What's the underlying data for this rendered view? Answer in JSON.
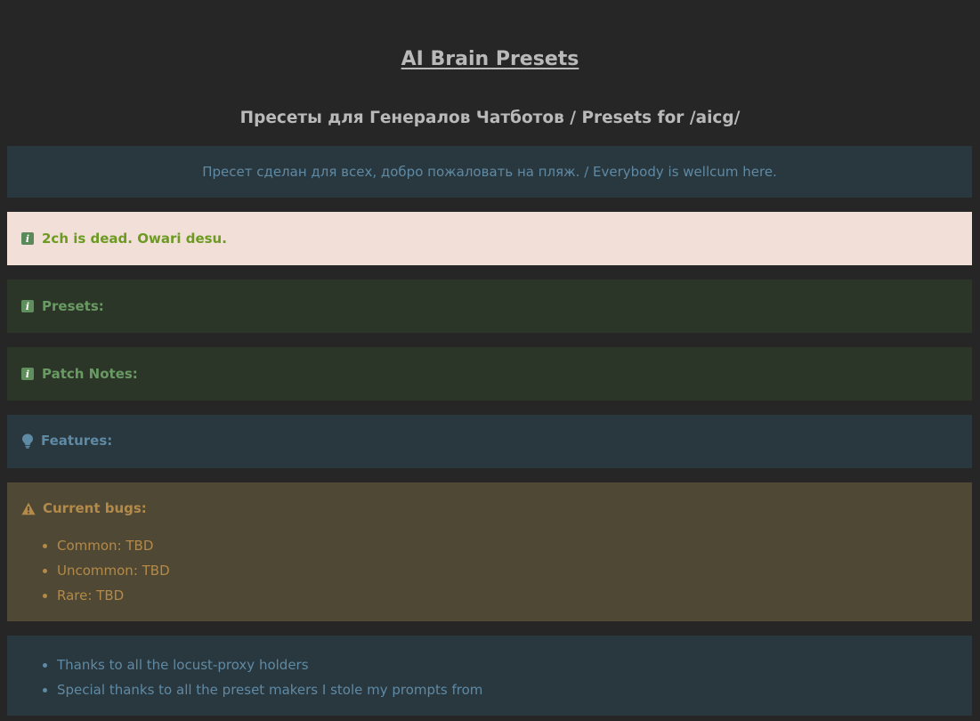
{
  "page": {
    "title": "AI Brain Presets",
    "subtitle": "Пресеты для Генералов Чатботов / Presets for /aicg/"
  },
  "welcome": {
    "text": "Пресет сделан для всех, добро пожаловать на пляж. / Everybody is wellcum here."
  },
  "notice": {
    "text": "2ch is dead. Owari desu.",
    "icon": "info-icon"
  },
  "presets": {
    "label": "Presets:",
    "icon": "info-icon"
  },
  "patch_notes": {
    "label": "Patch Notes:",
    "icon": "info-icon"
  },
  "features": {
    "label": "Features:",
    "icon": "lightbulb-icon"
  },
  "bugs": {
    "label": "Current bugs:",
    "icon": "warning-icon",
    "items": [
      "Common: TBD",
      "Uncommon: TBD",
      "Rare: TBD"
    ]
  },
  "thanks": {
    "items": [
      "Thanks to all the locust-proxy holders",
      "Special thanks to all the preset makers I stole my prompts from"
    ]
  },
  "colors": {
    "background": "#262626",
    "heading_text": "#b9b9b9",
    "blue_box": "#29373f",
    "blue_text": "#5f8aa4",
    "green_box": "#2c3628",
    "green_text": "#6a9a63",
    "pink_box": "#f2e0d8",
    "olive_text": "#6c9a22",
    "yellow_box": "#4f4834",
    "yellow_text": "#b38a4a"
  }
}
